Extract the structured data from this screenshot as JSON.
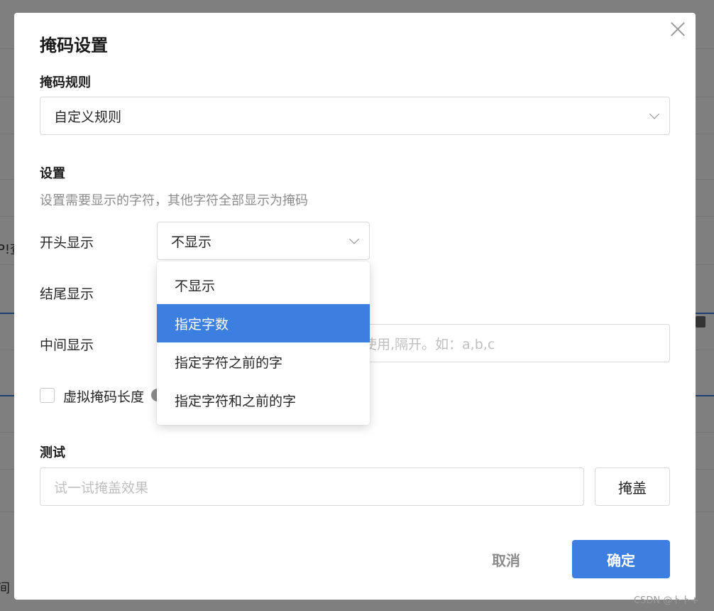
{
  "background": {
    "fragment_1": "P!查",
    "fragment_2": "间"
  },
  "modal": {
    "title": "掩码设置",
    "rule_label": "掩码规则",
    "rule_value": "自定义规则",
    "settings_label": "设置",
    "settings_hint": "设置需要显示的字符，其他字符全部显示为掩码",
    "start_label": "开头显示",
    "start_value": "不显示",
    "end_label": "结尾显示",
    "middle_label": "中间显示",
    "middle_placeholder_visible": "使用,隔开。如：a,b,c",
    "virtual_mask_label": "虚拟掩码长度",
    "virtual_mask_checked": false,
    "test_label": "测试",
    "test_placeholder": "试一试掩盖效果",
    "mask_button": "掩盖",
    "cancel_button": "取消",
    "ok_button": "确定"
  },
  "dropdown": {
    "options": [
      {
        "label": "不显示",
        "selected": false
      },
      {
        "label": "指定字数",
        "selected": true
      },
      {
        "label": "指定字符之前的字",
        "selected": false
      },
      {
        "label": "指定字符和之前的字",
        "selected": false
      }
    ]
  },
  "watermark": "CSDN @卜卜+",
  "colors": {
    "primary": "#3c7fe0",
    "overlay": "rgba(0,0,0,0.5)",
    "border": "#d9d9d9",
    "placeholder": "#bfbfbf"
  },
  "icons": {
    "close": "close-icon",
    "chevron": "chevron-down-icon",
    "help": "help-circle-icon"
  }
}
